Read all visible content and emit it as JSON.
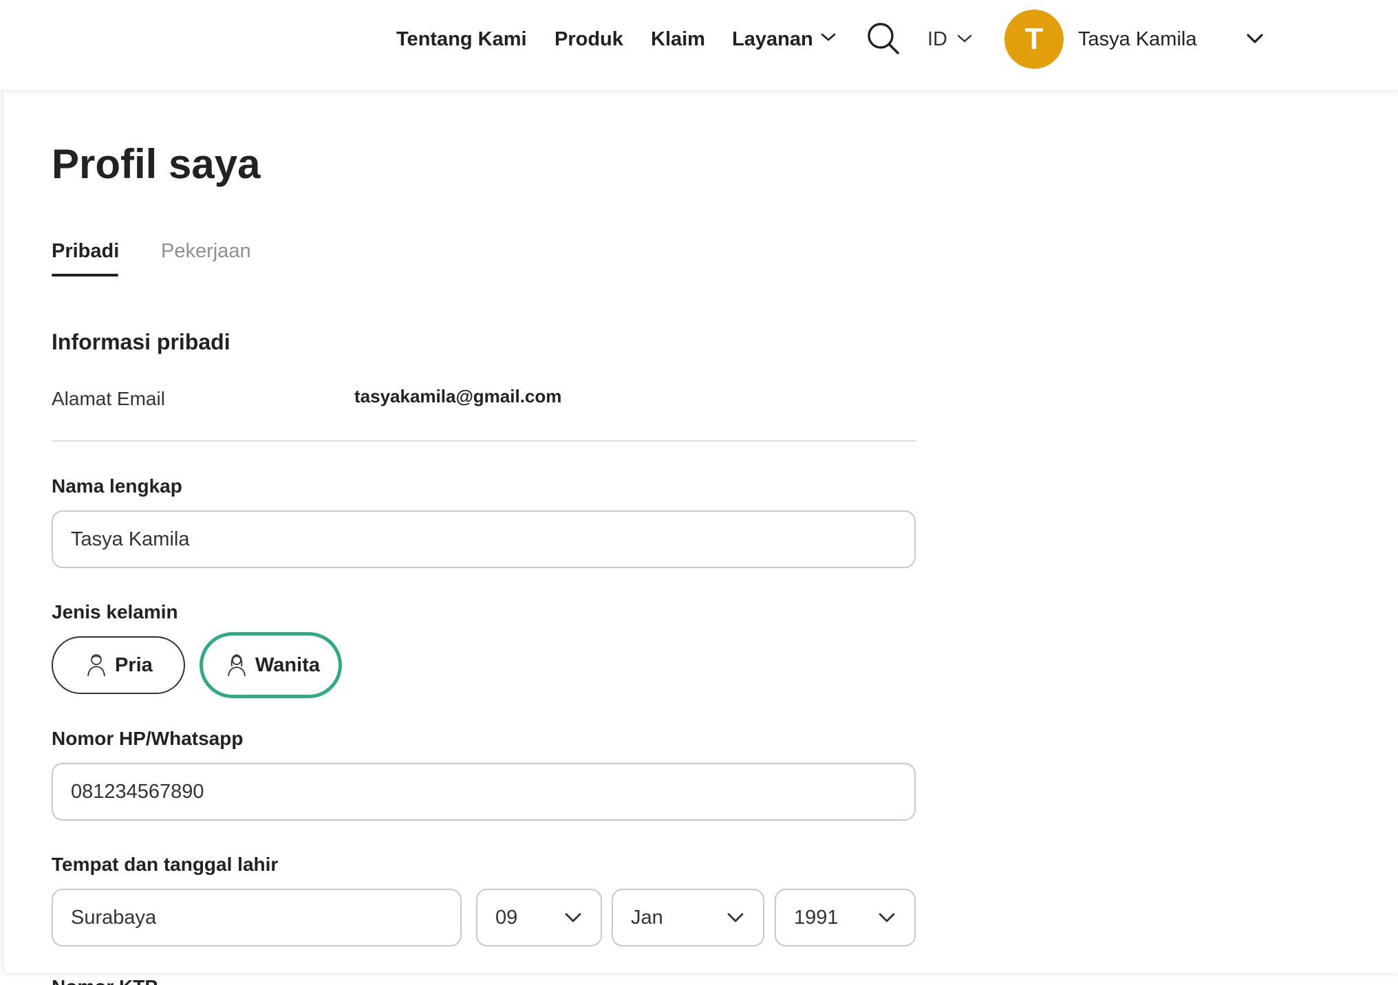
{
  "nav": {
    "links": [
      "Tentang Kami",
      "Produk",
      "Klaim",
      "Layanan"
    ],
    "layanan_icon": "chevron-down-icon",
    "search_icon": "search-icon",
    "language": "ID",
    "user": {
      "initial": "T",
      "name": "Tasya Kamila",
      "avatar_color": "#E39E0B"
    }
  },
  "page": {
    "title": "Profil saya",
    "tabs": [
      {
        "label": "Pribadi",
        "active": true
      },
      {
        "label": "Pekerjaan",
        "active": false
      }
    ]
  },
  "personal": {
    "section_title": "Informasi pribadi",
    "email": {
      "label": "Alamat Email",
      "value": "tasyakamila@gmail.com"
    },
    "full_name": {
      "label": "Nama lengkap",
      "value": "Tasya Kamila"
    },
    "gender": {
      "label": "Jenis kelamin",
      "options": [
        {
          "label": "Pria",
          "icon": "male-person-icon",
          "selected": false
        },
        {
          "label": "Wanita",
          "icon": "female-person-icon",
          "selected": true
        }
      ],
      "selected_color": "#2EAA88"
    },
    "phone": {
      "label": "Nomor HP/Whatsapp",
      "value": "081234567890"
    },
    "birth": {
      "label": "Tempat dan tanggal lahir",
      "place": "Surabaya",
      "day": "09",
      "month": "Jan",
      "year": "1991"
    },
    "next_field_label": "Nomor KTP"
  }
}
